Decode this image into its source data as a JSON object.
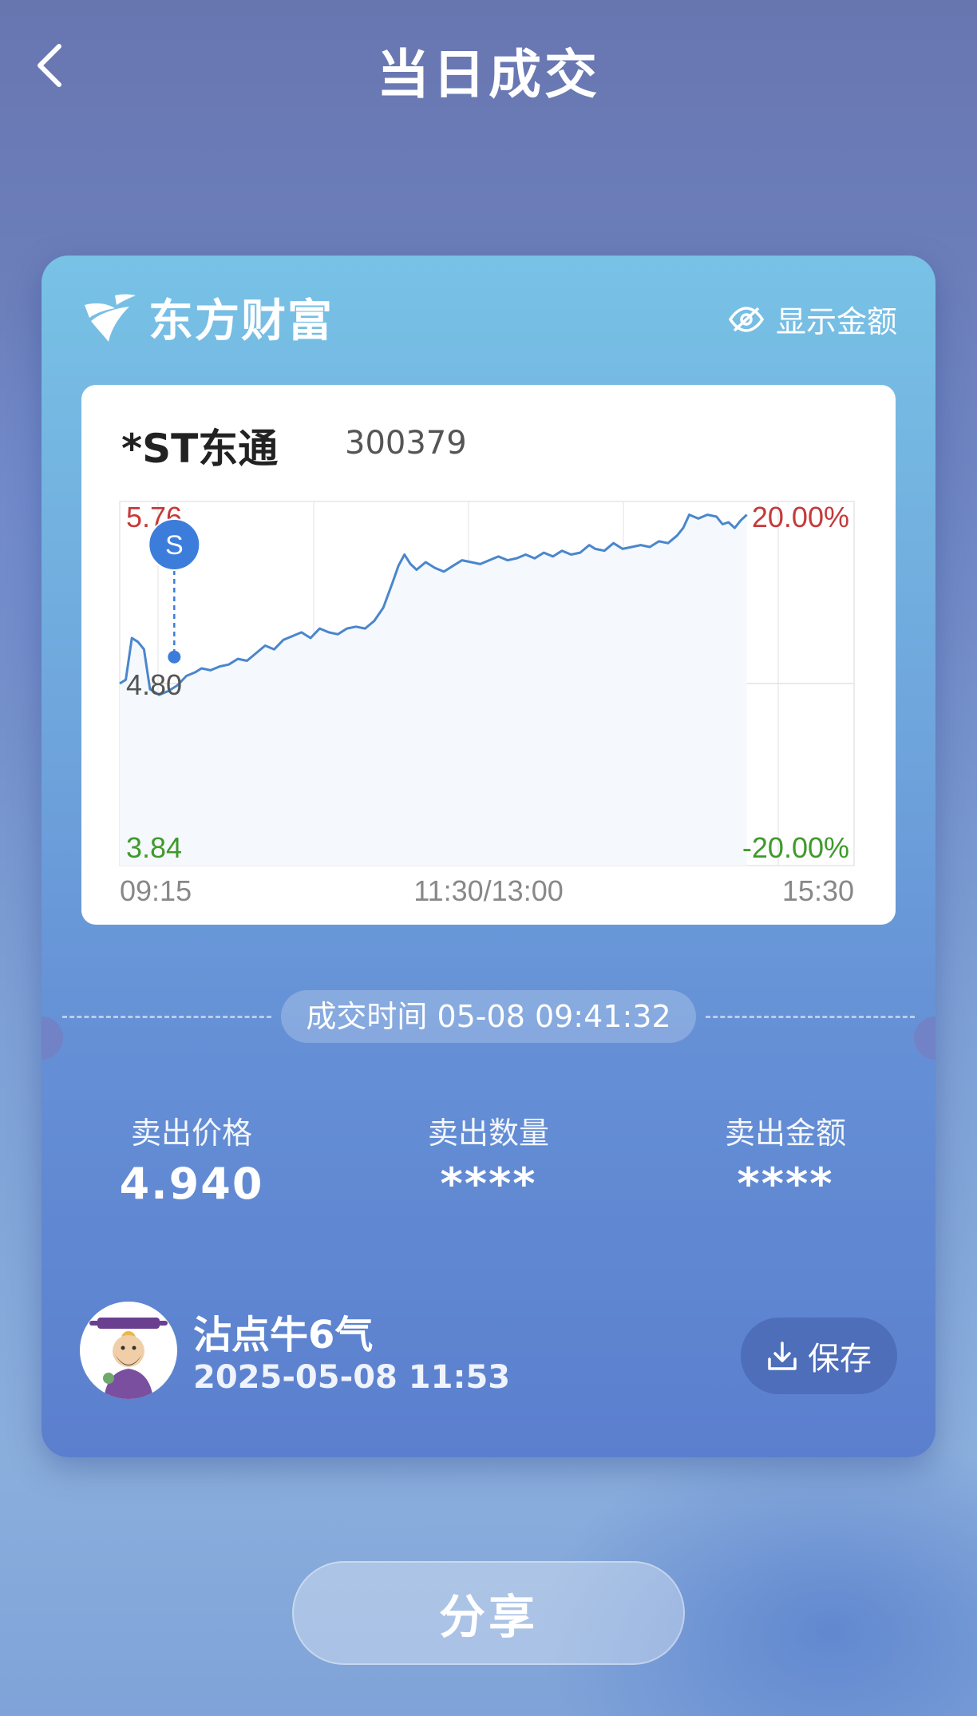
{
  "header": {
    "title": "当日成交"
  },
  "brand": {
    "name": "东方财富"
  },
  "toggle": {
    "show_amount_label": "显示金额"
  },
  "stock": {
    "name": "*ST东通",
    "code": "300379"
  },
  "chart_data": {
    "type": "line",
    "y_labels": {
      "top_left": "5.76",
      "mid_left": "4.80",
      "bottom_left": "3.84",
      "top_right": "20.00%",
      "bottom_right": "-20.00%"
    },
    "x_labels": [
      "09:15",
      "11:30/13:00",
      "15:30"
    ],
    "ylim": [
      3.84,
      5.76
    ],
    "reference_price": 4.8,
    "x_unit": "minutes since 09:30, 0-240 trading minutes",
    "series": [
      {
        "points": [
          [
            0,
            4.8
          ],
          [
            2,
            4.82
          ],
          [
            4,
            5.04
          ],
          [
            6,
            5.02
          ],
          [
            8,
            4.98
          ],
          [
            10,
            4.77
          ],
          [
            13,
            4.74
          ],
          [
            16,
            4.76
          ],
          [
            19,
            4.79
          ],
          [
            22,
            4.84
          ],
          [
            25,
            4.86
          ],
          [
            27,
            4.88
          ],
          [
            30,
            4.87
          ],
          [
            33,
            4.89
          ],
          [
            36,
            4.9
          ],
          [
            39,
            4.93
          ],
          [
            42,
            4.92
          ],
          [
            45,
            4.96
          ],
          [
            48,
            5.0
          ],
          [
            51,
            4.98
          ],
          [
            54,
            5.03
          ],
          [
            57,
            5.05
          ],
          [
            60,
            5.07
          ],
          [
            63,
            5.04
          ],
          [
            66,
            5.09
          ],
          [
            69,
            5.07
          ],
          [
            72,
            5.06
          ],
          [
            75,
            5.09
          ],
          [
            78,
            5.1
          ],
          [
            81,
            5.09
          ],
          [
            84,
            5.13
          ],
          [
            87,
            5.2
          ],
          [
            90,
            5.33
          ],
          [
            92,
            5.42
          ],
          [
            94,
            5.48
          ],
          [
            96,
            5.43
          ],
          [
            98,
            5.4
          ],
          [
            101,
            5.44
          ],
          [
            104,
            5.41
          ],
          [
            107,
            5.39
          ],
          [
            110,
            5.42
          ],
          [
            113,
            5.45
          ],
          [
            116,
            5.44
          ],
          [
            119,
            5.43
          ],
          [
            122,
            5.45
          ],
          [
            125,
            5.47
          ],
          [
            128,
            5.45
          ],
          [
            131,
            5.46
          ],
          [
            134,
            5.48
          ],
          [
            137,
            5.46
          ],
          [
            140,
            5.49
          ],
          [
            143,
            5.47
          ],
          [
            146,
            5.5
          ],
          [
            149,
            5.48
          ],
          [
            152,
            5.49
          ],
          [
            155,
            5.53
          ],
          [
            157,
            5.51
          ],
          [
            160,
            5.5
          ],
          [
            163,
            5.54
          ],
          [
            166,
            5.51
          ],
          [
            169,
            5.52
          ],
          [
            172,
            5.53
          ],
          [
            175,
            5.52
          ],
          [
            178,
            5.55
          ],
          [
            181,
            5.54
          ],
          [
            184,
            5.58
          ],
          [
            186,
            5.62
          ],
          [
            188,
            5.69
          ],
          [
            191,
            5.67
          ],
          [
            194,
            5.69
          ],
          [
            197,
            5.68
          ],
          [
            199,
            5.64
          ],
          [
            201,
            5.65
          ],
          [
            203,
            5.62
          ],
          [
            205,
            5.66
          ],
          [
            207,
            5.69
          ]
        ],
        "color": "#4a86cc"
      }
    ],
    "marker": {
      "label": "S",
      "x": 18,
      "y": 4.94,
      "color": "#3c7ddc"
    },
    "colors": {
      "up": "#c53a3a",
      "down": "#3f9a2a",
      "neutral": "#555555",
      "grid": "#e6e6e6",
      "fill": "#f5f8fd"
    }
  },
  "trade": {
    "time_label": "成交时间 05-08 09:41:32",
    "sell_price_label": "卖出价格",
    "sell_price": "4.940",
    "sell_qty_label": "卖出数量",
    "sell_qty": "****",
    "sell_amount_label": "卖出金额",
    "sell_amount": "****"
  },
  "user": {
    "name": "沾点牛6气",
    "timestamp": "2025-05-08 11:53",
    "avatar_icon": "caishen-avatar"
  },
  "actions": {
    "save_label": "保存",
    "share_label": "分享"
  }
}
